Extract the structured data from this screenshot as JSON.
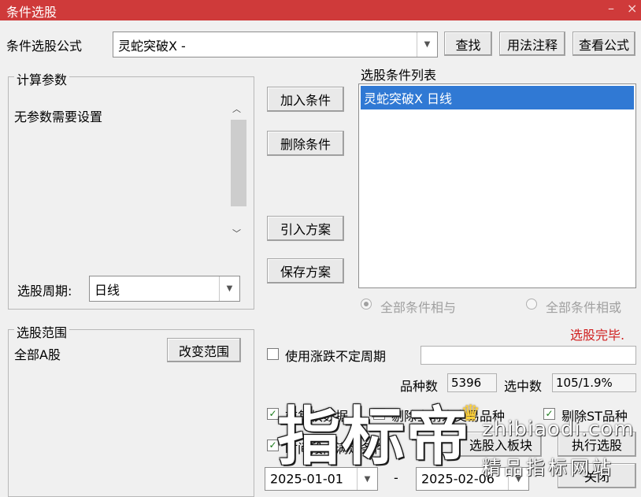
{
  "window": {
    "title": "条件选股",
    "minimize": "–",
    "close": "×"
  },
  "formula": {
    "label": "条件选股公式",
    "value": "灵蛇突破X  -",
    "find_btn": "查找",
    "usage_btn": "用法注释",
    "view_btn": "查看公式"
  },
  "params": {
    "group_label": "计算参数",
    "message": "无参数需要设置",
    "period_label": "选股周期:",
    "period_value": "日线"
  },
  "actions": {
    "add": "加入条件",
    "delete": "删除条件",
    "import": "引入方案",
    "save": "保存方案"
  },
  "conditions": {
    "label": "选股条件列表",
    "items": [
      "灵蛇突破X  日线"
    ]
  },
  "logic": {
    "and_label": "全部条件相与",
    "or_label": "全部条件相或"
  },
  "status": {
    "text": "选股完毕.",
    "color": "#d02020"
  },
  "scope": {
    "group_label": "选股范围",
    "value": "全部A股",
    "change_btn": "改变范围"
  },
  "options": {
    "variable_period": "使用涨跌不定周期",
    "total_label": "品种数",
    "total_value": "5396",
    "selected_label": "选中数",
    "selected_value": "105/1.9%",
    "pre_adjust": "前复权数据",
    "exclude_suspended": "剔除当前未交易品种",
    "exclude_st": "剔除ST品种",
    "time_range": "时间段内满足条件"
  },
  "bottom": {
    "to_block_btn": "选股入板块",
    "execute_btn": "执行选股",
    "close_btn": "关闭",
    "date_from": "2025-01-01",
    "date_sep": "-",
    "date_to": "2025-02-06"
  },
  "watermark": {
    "big": "指标帝",
    "domain": "zhibiaodi.com",
    "tagline": "精品指标网站"
  }
}
